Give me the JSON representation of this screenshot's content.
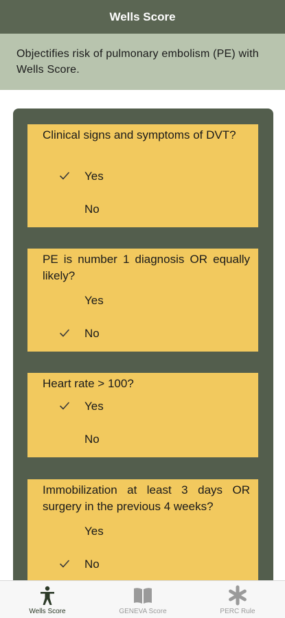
{
  "header": {
    "title": "Wells Score"
  },
  "description": "Objectifies risk of pulmonary embolism (PE) with Wells Score.",
  "questions": [
    {
      "text": "Clinical signs and symptoms of DVT?",
      "options": [
        {
          "label": "Yes",
          "selected": true
        },
        {
          "label": "No",
          "selected": false
        }
      ]
    },
    {
      "text": "PE is number 1 diagnosis OR equally likely?",
      "options": [
        {
          "label": "Yes",
          "selected": false
        },
        {
          "label": "No",
          "selected": true
        }
      ]
    },
    {
      "text": "Heart rate > 100?",
      "options": [
        {
          "label": "Yes",
          "selected": true
        },
        {
          "label": "No",
          "selected": false
        }
      ]
    },
    {
      "text": "Immobilization at least 3 days OR surgery in the previous 4 weeks?",
      "options": [
        {
          "label": "Yes",
          "selected": false
        },
        {
          "label": "No",
          "selected": true
        }
      ]
    }
  ],
  "tabs": [
    {
      "label": "Wells Score",
      "icon": "person-icon",
      "active": true
    },
    {
      "label": "GENEVA Score",
      "icon": "book-icon",
      "active": false
    },
    {
      "label": "PERC Rule",
      "icon": "asterisk-icon",
      "active": false
    }
  ],
  "colors": {
    "navbar": "#5b6653",
    "description_bg": "#b8c4ae",
    "panel": "#535e4d",
    "card": "#f2c95e",
    "tab_active": "#2c3a28",
    "tab_inactive": "#9a9a9a"
  }
}
